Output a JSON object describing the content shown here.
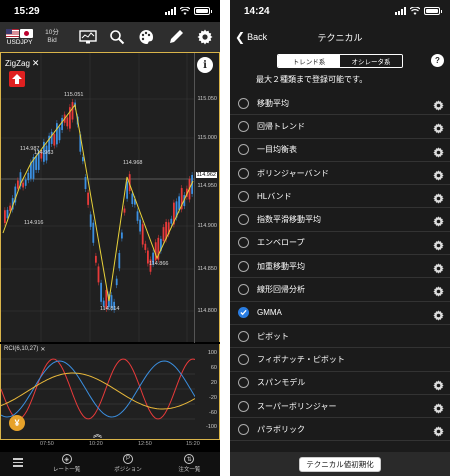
{
  "left": {
    "status": {
      "time": "15:29"
    },
    "toolbar": {
      "pair": "USDJPY",
      "timeframe_top": "10分",
      "timeframe_bottom": "Bid"
    },
    "indicator": {
      "name": "ZigZag",
      "close_icon": "close-icon"
    },
    "price_axis": [
      "115.050",
      "115.000",
      "114.962",
      "114.950",
      "114.900",
      "114.850",
      "114.800"
    ],
    "current_price": "114.962",
    "point_labels": [
      "115.051",
      "114.987",
      "114.963",
      "114.968",
      "114.916",
      "114.866",
      "114.814"
    ],
    "rsi": {
      "label": "RCI(6,10,27)",
      "axis": [
        "100",
        "60",
        "20",
        "-20",
        "-60",
        "-100"
      ]
    },
    "time_axis": [
      "07:50",
      "10:20",
      "12:50",
      "15:20"
    ],
    "tabs": {
      "left": "レート一覧",
      "center": "ポジション",
      "right": "注文一覧"
    },
    "colors": {
      "up": "#e83a3a",
      "down": "#3b8fe0",
      "zigzag": "#e8d23a",
      "frame": "#d9b44a"
    }
  },
  "right": {
    "status": {
      "time": "14:24"
    },
    "nav": {
      "back_label": "Back",
      "title": "テクニカル"
    },
    "segments": {
      "trend": "トレンド系",
      "oscillator": "オシレータ系"
    },
    "notice": "最大２種類まで登録可能です。",
    "items": [
      {
        "label": "移動平均",
        "checked": false,
        "gear": true
      },
      {
        "label": "回帰トレンド",
        "checked": false,
        "gear": true
      },
      {
        "label": "一目均衡表",
        "checked": false,
        "gear": true
      },
      {
        "label": "ボリンジャーバンド",
        "checked": false,
        "gear": true
      },
      {
        "label": "HLバンド",
        "checked": false,
        "gear": true
      },
      {
        "label": "指数平滑移動平均",
        "checked": false,
        "gear": true
      },
      {
        "label": "エンベロープ",
        "checked": false,
        "gear": true
      },
      {
        "label": "加重移動平均",
        "checked": false,
        "gear": true
      },
      {
        "label": "線形回帰分析",
        "checked": false,
        "gear": true
      },
      {
        "label": "GMMA",
        "checked": true,
        "gear": true
      },
      {
        "label": "ピボット",
        "checked": false,
        "gear": false
      },
      {
        "label": "フィボナッチ・ピボット",
        "checked": false,
        "gear": false
      },
      {
        "label": "スパンモデル",
        "checked": false,
        "gear": true
      },
      {
        "label": "スーパーボリンジャー",
        "checked": false,
        "gear": true
      },
      {
        "label": "パラボリック",
        "checked": false,
        "gear": true
      }
    ],
    "reset_label": "テクニカル値初期化",
    "colors": {
      "checked": "#2a7de1"
    }
  }
}
